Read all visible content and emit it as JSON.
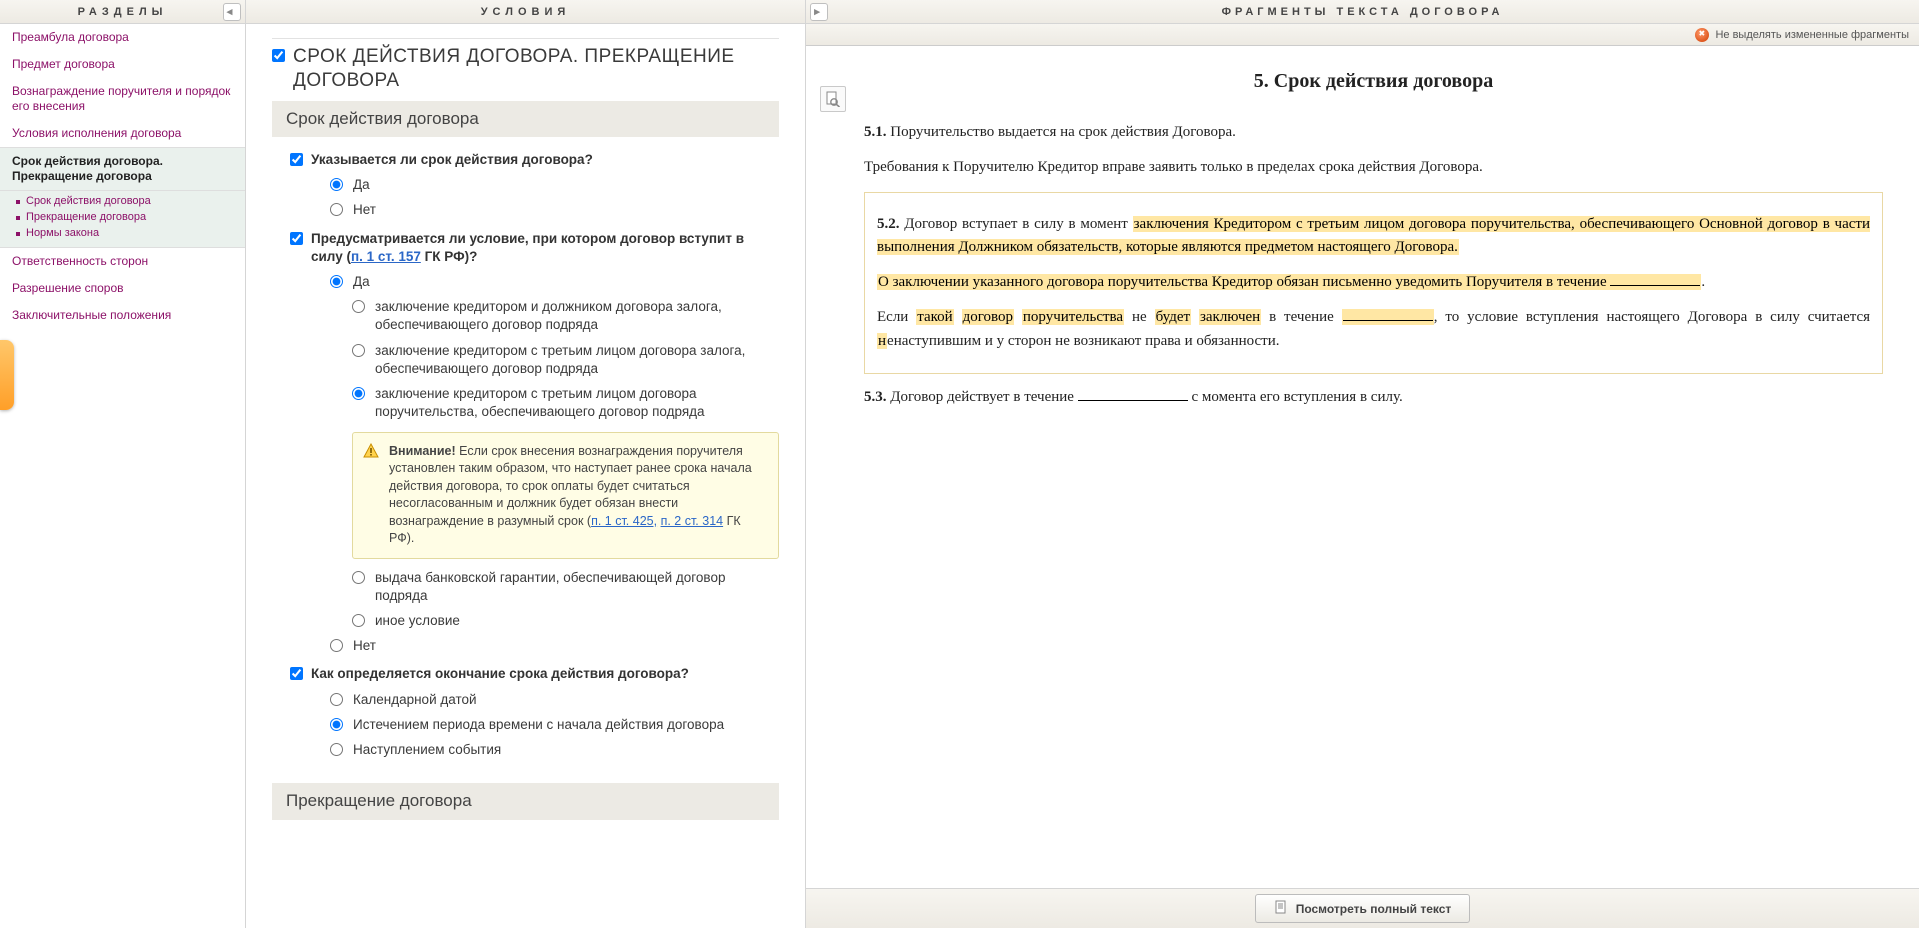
{
  "sidebar": {
    "title": "РАЗДЕЛЫ",
    "items": [
      {
        "label": "Преамбула договора"
      },
      {
        "label": "Предмет договора"
      },
      {
        "label": "Вознаграждение поручителя и порядок его внесения"
      },
      {
        "label": "Условия исполнения договора"
      },
      {
        "label": "Срок действия договора. Прекращение договора",
        "active": true
      },
      {
        "label": "Ответственность сторон"
      },
      {
        "label": "Разрешение споров"
      },
      {
        "label": "Заключительные положения"
      }
    ],
    "active_sub": [
      {
        "label": "Срок действия договора"
      },
      {
        "label": "Прекращение договора"
      },
      {
        "label": "Нормы закона"
      }
    ]
  },
  "middle": {
    "title": "УСЛОВИЯ",
    "section_title": "СРОК ДЕЙСТВИЯ ДОГОВОРА. ПРЕКРАЩЕНИЕ ДОГОВОРА",
    "block1_title": "Срок действия договора",
    "block2_title": "Прекращение договора",
    "q1": {
      "text": "Указывается ли срок действия договора?",
      "opts": [
        "Да",
        "Нет"
      ],
      "selected": 0
    },
    "q2": {
      "text_prefix": "Предусматривается ли условие, при котором договор вступит в силу (",
      "link": "п. 1 ст. 157",
      "text_suffix": " ГК РФ)?",
      "top": [
        "Да"
      ],
      "sub": [
        "заключение кредитором и должником  договора залога, обеспечивающего договор подряда",
        "заключение кредитором с третьим лицом договора залога, обеспечивающего договор подряда",
        "заключение кредитором с третьим лицом договора поручительства, обеспечивающего договор подряда",
        "выдача банковской гарантии, обеспечивающей договор подряда",
        "иное условие"
      ],
      "sub_selected": 2,
      "bottom": [
        "Нет"
      ]
    },
    "note": {
      "bold": "Внимание!",
      "text": " Если срок внесения вознаграждения поручителя установлен таким образом, что наступает ранее срока начала действия договора, то срок оплаты будет считаться несогласованным и должник будет обязан внести вознаграждение в разумный срок (",
      "link1": "п. 1 ст. 425,",
      "link2": "п. 2 ст. 314",
      "tail": " ГК РФ)."
    },
    "q3": {
      "text": "Как определяется окончание срока действия договора?",
      "opts": [
        "Календарной датой",
        "Истечением периода времени с начала действия договора",
        "Наступлением события"
      ],
      "selected": 1
    }
  },
  "right": {
    "title": "ФРАГМЕНТЫ ТЕКСТА ДОГОВОРА",
    "no_highlight": "Не выделять измененные фрагменты",
    "doc_title_num": "5. ",
    "doc_title": "Срок действия договора",
    "p51": {
      "num": "5.1.",
      "text": " Поручительство выдается на срок действия Договора."
    },
    "p_req": "Требования к Поручителю Кредитор вправе заявить только в пределах срока действия Договора.",
    "p52": {
      "num": "5.2.",
      "t1": " Договор вступает в силу в момент ",
      "h1": "заключения Кредитором с третьим лицом договора поручительства, обеспечивающего Основной договор в части выполнения Должником обязательств, которые являются предметом настоящего Договора."
    },
    "p52b": {
      "t1": "О заключении указанного договора поручительства Кредитор обязан письменно уведомить Поручителя в течение "
    },
    "p52c": {
      "t1": "Если ",
      "h1": "такой",
      "t2": " ",
      "h2": "договор",
      "t3": " ",
      "h3": "поручительства",
      "t4": " не ",
      "h4": "будет",
      "t5": " ",
      "h5": "заключен",
      "t6": " в течение ",
      "t7": ", то условие вступления настоящего Договора в силу считается ",
      "h6": "н",
      "t8": "енаступившим и у сторон не возникают права и обязанности."
    },
    "p53": {
      "num": "5.3.",
      "t1": " Договор действует в течение ",
      "t2": " с момента его вступления в силу."
    },
    "view_full": "Посмотреть полный текст"
  }
}
